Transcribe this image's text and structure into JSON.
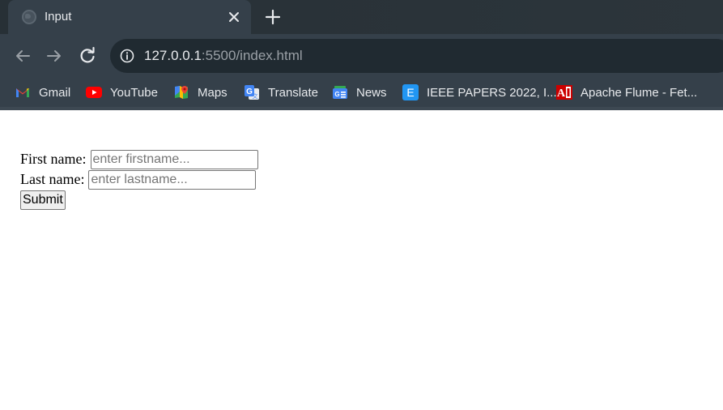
{
  "browser": {
    "tab": {
      "title": "Input"
    },
    "address_bar": {
      "host": "127.0.0.1",
      "path": ":5500/index.html"
    },
    "bookmarks": [
      {
        "label": "Gmail",
        "icon": "gmail-icon"
      },
      {
        "label": "YouTube",
        "icon": "youtube-icon"
      },
      {
        "label": "Maps",
        "icon": "maps-icon"
      },
      {
        "label": "Translate",
        "icon": "translate-icon"
      },
      {
        "label": "News",
        "icon": "news-icon"
      },
      {
        "label": "IEEE PAPERS 2022, I...",
        "icon": "ieee-icon"
      },
      {
        "label": "Apache Flume - Fet...",
        "icon": "apache-flume-icon"
      }
    ],
    "colors": {
      "frame": "#35404a",
      "tabstrip": "#2a3238",
      "omnibox": "#202a31"
    }
  },
  "form": {
    "first_name_label": "First name:",
    "first_name_placeholder": "enter firstname...",
    "first_name_value": "",
    "last_name_label": "Last name:",
    "last_name_placeholder": "enter lastname...",
    "last_name_value": "",
    "submit_label": "Submit"
  }
}
